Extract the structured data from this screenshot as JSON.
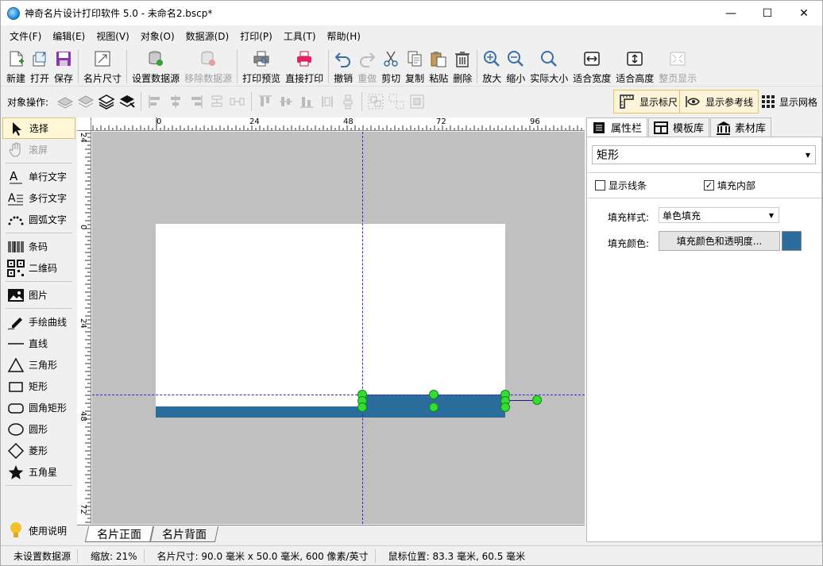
{
  "window": {
    "title": "神奇名片设计打印软件 5.0 - 未命名2.bscp*",
    "minimize": "—",
    "maximize": "☐",
    "close": "✕"
  },
  "menu": [
    "文件(F)",
    "编辑(E)",
    "视图(V)",
    "对象(O)",
    "数据源(D)",
    "打印(P)",
    "工具(T)",
    "帮助(H)"
  ],
  "toolbar": {
    "new": "新建",
    "open": "打开",
    "save": "保存",
    "card_size": "名片尺寸",
    "set_datasource": "设置数据源",
    "remove_datasource": "移除数据源",
    "print_preview": "打印预览",
    "direct_print": "直接打印",
    "undo": "撤销",
    "redo": "重做",
    "cut": "剪切",
    "copy": "复制",
    "paste": "粘贴",
    "delete": "删除",
    "zoom_in": "放大",
    "zoom_out": "缩小",
    "actual_size": "实际大小",
    "fit_width": "适合宽度",
    "fit_height": "适合高度",
    "page_fit": "整页显示"
  },
  "objbar": {
    "label": "对象操作:",
    "show_ruler": "显示标尺",
    "show_guides": "显示参考线",
    "show_grid": "显示网格"
  },
  "tools": {
    "select": "选择",
    "pan": "滚屏",
    "single_text": "单行文字",
    "multi_text": "多行文字",
    "arc_text": "圆弧文字",
    "barcode": "条码",
    "qrcode": "二维码",
    "image": "图片",
    "freehand": "手绘曲线",
    "line": "直线",
    "triangle": "三角形",
    "rectangle": "矩形",
    "round_rect": "圆角矩形",
    "circle": "圆形",
    "diamond": "菱形",
    "star": "五角星",
    "help": "使用说明"
  },
  "ruler": {
    "top_ticks": [
      "0",
      "24",
      "48",
      "72",
      "96"
    ],
    "left_ticks": [
      "24",
      "0",
      "24",
      "48",
      "72"
    ]
  },
  "page_tabs": {
    "front": "名片正面",
    "back": "名片背面"
  },
  "right_panel": {
    "tabs": {
      "properties": "属性栏",
      "templates": "模板库",
      "materials": "素材库"
    },
    "shape_type": "矩形",
    "show_border_label": "显示线条",
    "show_border_checked": false,
    "fill_inside_label": "填充内部",
    "fill_inside_checked": true,
    "fill_style_label": "填充样式:",
    "fill_style_value": "单色填充",
    "fill_color_label": "填充颜色:",
    "fill_color_button": "填充颜色和透明度...",
    "fill_color": "#2a6d9c"
  },
  "status": {
    "datasource": "未设置数据源",
    "zoom": "缩放: 21%",
    "card_size": "名片尺寸: 90.0 毫米 x 50.0 毫米, 600 像素/英寸",
    "mouse_pos": "鼠标位置: 83.3 毫米, 60.5 毫米"
  }
}
